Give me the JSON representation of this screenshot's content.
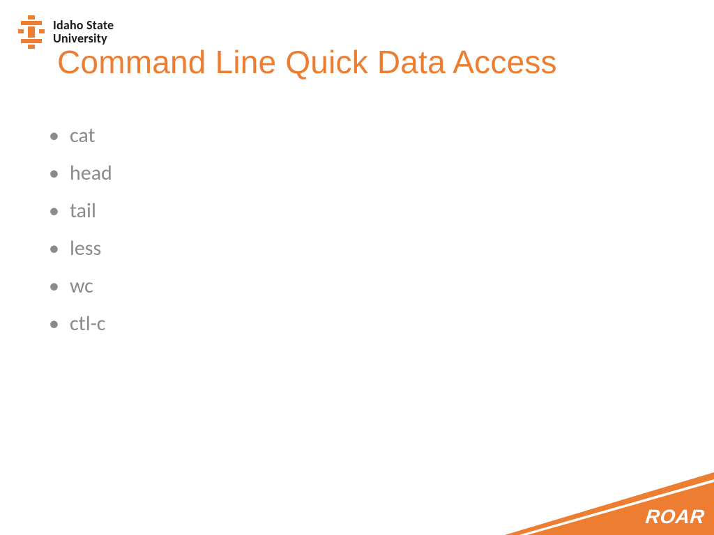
{
  "brand": {
    "line1": "Idaho State",
    "line2": "University"
  },
  "title": "Command Line Quick Data Access",
  "bullets": [
    "cat",
    "head",
    "tail",
    "less",
    "wc",
    "ctl-c"
  ],
  "footer": {
    "roar": "ROAR"
  },
  "colors": {
    "accent": "#ed7d31",
    "text_muted": "#888a8c",
    "brand_black": "#1a1a1a"
  }
}
